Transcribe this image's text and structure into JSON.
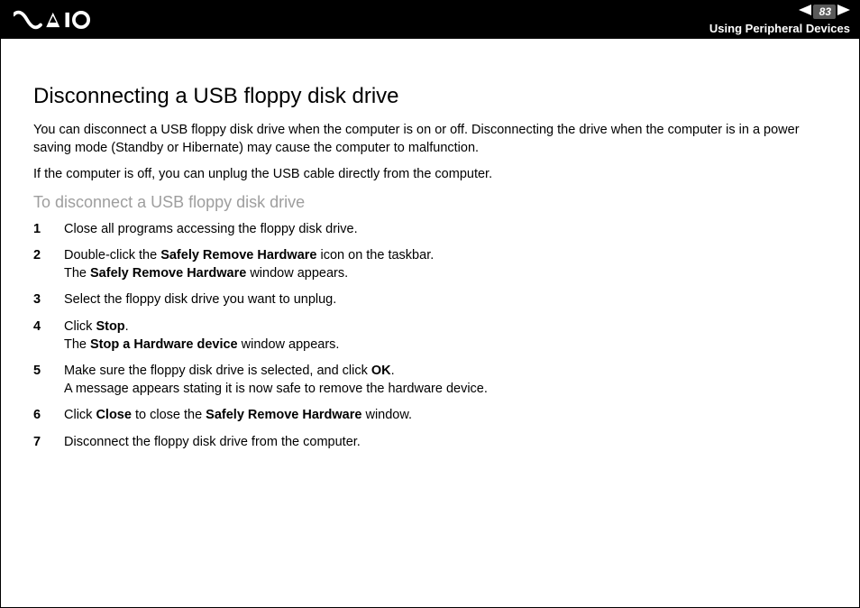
{
  "header": {
    "page_number": "83",
    "section": "Using Peripheral Devices"
  },
  "title": "Disconnecting a USB floppy disk drive",
  "intro1": "You can disconnect a USB floppy disk drive when the computer is on or off. Disconnecting the drive when the computer is in a power saving mode (Standby or Hibernate) may cause the computer to malfunction.",
  "intro2": "If the computer is off, you can unplug the USB cable directly from the computer.",
  "subhead": "To disconnect a USB floppy disk drive",
  "steps": {
    "s1": "Close all programs accessing the floppy disk drive.",
    "s2a": "Double-click the ",
    "s2b": "Safely Remove Hardware",
    "s2c": " icon on the taskbar.",
    "s2d": "The ",
    "s2e": "Safely Remove Hardware",
    "s2f": " window appears.",
    "s3": "Select the floppy disk drive you want to unplug.",
    "s4a": "Click ",
    "s4b": "Stop",
    "s4c": ".",
    "s4d": "The ",
    "s4e": "Stop a Hardware device",
    "s4f": " window appears.",
    "s5a": "Make sure the floppy disk drive is selected, and click ",
    "s5b": "OK",
    "s5c": ".",
    "s5d": "A message appears stating it is now safe to remove the hardware device.",
    "s6a": "Click ",
    "s6b": "Close",
    "s6c": " to close the ",
    "s6d": "Safely Remove Hardware",
    "s6e": " window.",
    "s7": "Disconnect the floppy disk drive from the computer."
  }
}
